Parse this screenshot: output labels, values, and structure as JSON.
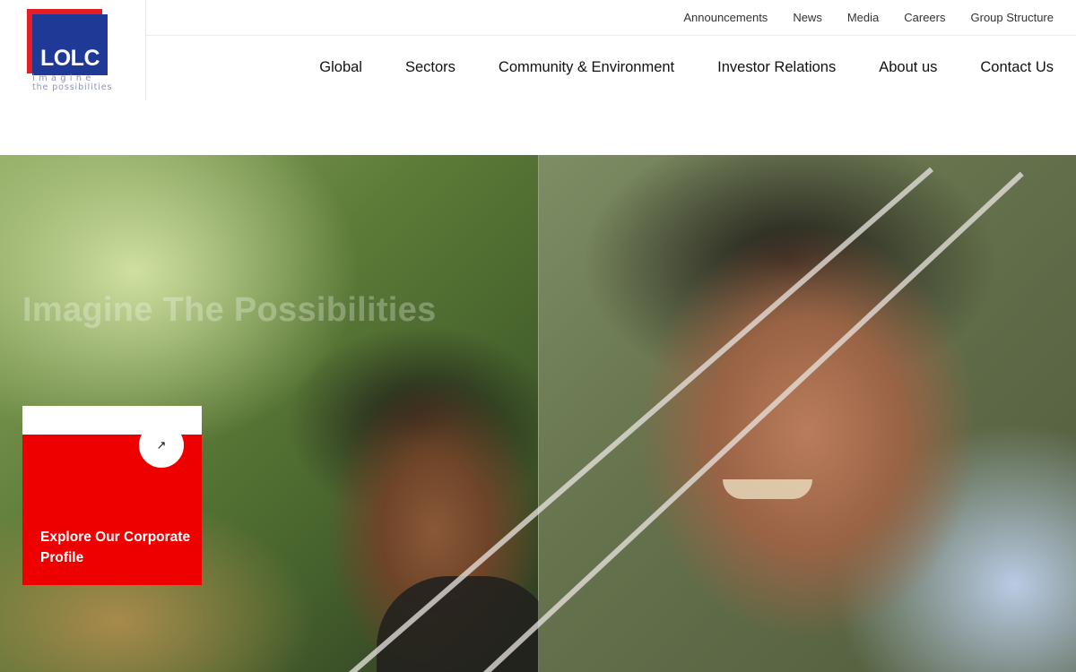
{
  "brand": {
    "logo_text": "LOLC",
    "tagline_line1": "imagine",
    "tagline_line2": "the possibilities",
    "colors": {
      "red": "#e51e25",
      "blue": "#1e3a96",
      "card_red": "#ee0000"
    }
  },
  "utility_nav": [
    "Announcements",
    "News",
    "Media",
    "Careers",
    "Group Structure"
  ],
  "main_nav": [
    "Global",
    "Sectors",
    "Community & Environment",
    "Investor Relations",
    "About us",
    "Contact Us"
  ],
  "hero": {
    "headline": "Imagine The Possibilities",
    "card": {
      "label": "Explore Our Corporate Profile",
      "arrow_icon": "↗"
    }
  }
}
